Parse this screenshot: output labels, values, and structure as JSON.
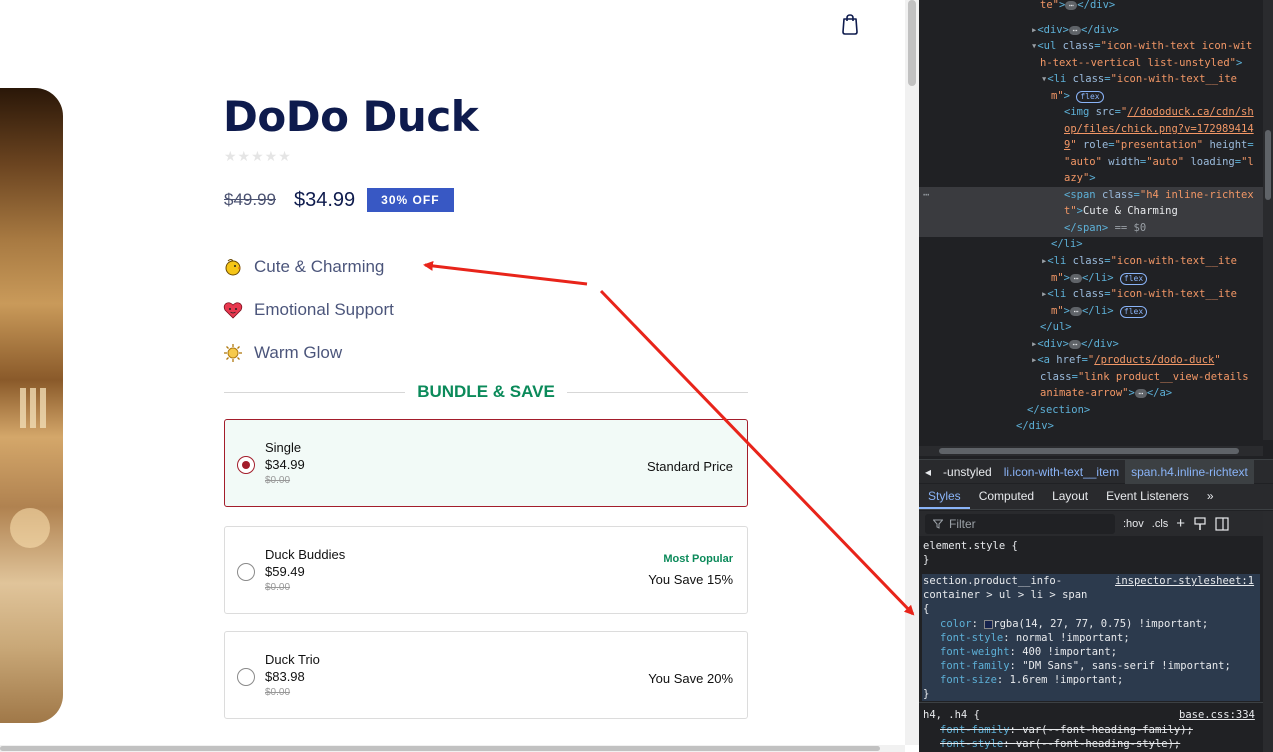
{
  "product": {
    "title": "DoDo Duck",
    "stars": "★★★★★",
    "old_price": "$49.99",
    "new_price": "$34.99",
    "discount_badge": "30% OFF",
    "features": [
      {
        "icon": "chick-icon",
        "glyph": "🐤",
        "label": "Cute & Charming"
      },
      {
        "icon": "heart-face-icon",
        "glyph": "❤",
        "label": "Emotional Support"
      },
      {
        "icon": "sun-icon",
        "glyph": "☀",
        "label": "Warm Glow"
      }
    ],
    "bundle_heading": "BUNDLE & SAVE",
    "bundle_options": [
      {
        "name": "Single",
        "price": "$34.99",
        "strike": "$0.00",
        "tag": "",
        "save": "Standard Price",
        "selected": true
      },
      {
        "name": "Duck Buddies",
        "price": "$59.49",
        "strike": "$0.00",
        "tag": "Most Popular",
        "save": "You Save 15%",
        "selected": false
      },
      {
        "name": "Duck Trio",
        "price": "$83.98",
        "strike": "$0.00",
        "tag": "",
        "save": "You Save 20%",
        "selected": false
      }
    ]
  },
  "devtools": {
    "breadcrumbs": [
      "-unstyled",
      "li.icon-with-text__item",
      "span.h4.inline-richtext"
    ],
    "tabs": [
      "Styles",
      "Computed",
      "Layout",
      "Event Listeners",
      "»"
    ],
    "filter_placeholder": "Filter",
    "filter_tools": [
      ":hov",
      ".cls",
      "+"
    ],
    "element_style": "element.style {",
    "element_style_close": "}",
    "rule_selector_1": "section.product__info-",
    "rule_selector_2": "container > ul > li > span",
    "rule_source": "inspector-stylesheet:1",
    "rule_open": "{",
    "rule_close": "}",
    "rule_props": [
      {
        "name": "color",
        "value": "rgba(14, 27, 77, 0.75) !important;"
      },
      {
        "name": "font-style",
        "value": "normal !important;"
      },
      {
        "name": "font-weight",
        "value": "400 !important;"
      },
      {
        "name": "font-family",
        "value": "\"DM Sans\", sans-serif !important;"
      },
      {
        "name": "font-size",
        "value": "1.6rem !important;"
      }
    ],
    "rule2_selector": "h4, .h4 {",
    "rule2_source": "base.css:334",
    "rule2_props": [
      {
        "name": "font-family",
        "value": "var(--font-heading-family);"
      },
      {
        "name": "font-style",
        "value": "var(--font-heading-style);"
      }
    ],
    "colors": {
      "accent": "#8ab4f8",
      "tag": "#5db0d7",
      "value": "#f29766"
    }
  }
}
